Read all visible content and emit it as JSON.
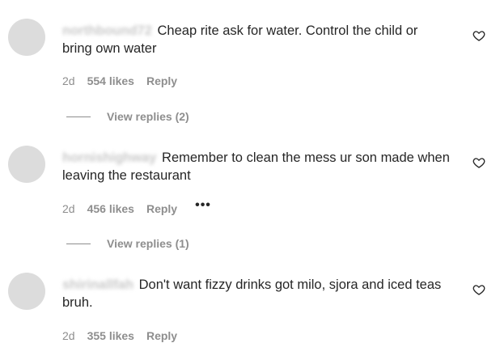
{
  "comments": [
    {
      "username": "northbound72",
      "text": "Cheap rite ask for water. Control the child or bring own water",
      "time": "2d",
      "likes": "554 likes",
      "reply_label": "Reply",
      "view_replies": "View replies (2)"
    },
    {
      "username": "hornishighway",
      "text": "Remember to clean the mess ur son made when leaving the restaurant",
      "time": "2d",
      "likes": "456 likes",
      "reply_label": "Reply",
      "more_label": "•••",
      "view_replies": "View replies (1)"
    },
    {
      "username": "shirinallfah",
      "text": "Don't want fizzy drinks got milo, sjora and iced teas bruh.",
      "time": "2d",
      "likes": "355 likes",
      "reply_label": "Reply"
    }
  ],
  "icons": {
    "avatar": "avatar-placeholder",
    "like": "heart-outline-icon",
    "more": "more-options-icon"
  },
  "colors": {
    "text": "#262626",
    "secondary": "#8e8e8e",
    "avatar": "#dcdcdc",
    "background": "#ffffff"
  }
}
